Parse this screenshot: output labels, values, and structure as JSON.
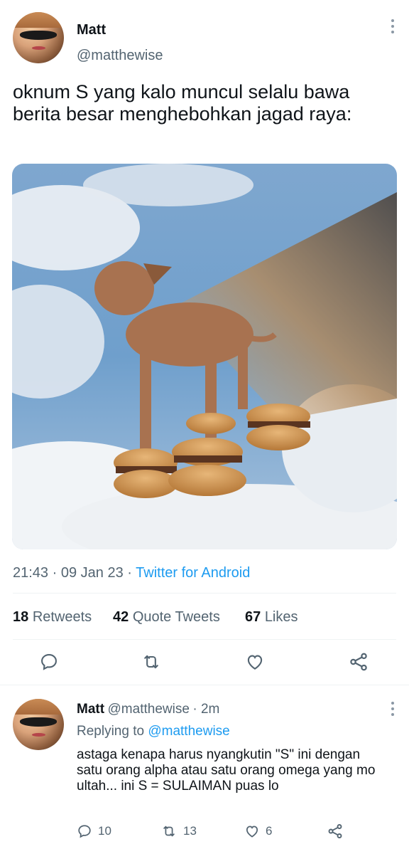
{
  "tweet": {
    "author_name": "Matt",
    "author_handle": "@matthewise",
    "text": "oknum S yang kalo muncul selalu bawa berita besar menghebohkan jagad raya:",
    "time": "21:43",
    "date": "09 Jan 23",
    "separator": "·",
    "source": "Twitter for Android",
    "image_description": "photo",
    "stats": {
      "retweets_count": "18",
      "retweets_label": "Retweets",
      "quotes_count": "42",
      "quotes_label": "Quote Tweets",
      "likes_count": "67",
      "likes_label": "Likes"
    }
  },
  "reply": {
    "author_name": "Matt",
    "author_handle": "@matthewise",
    "time_ago": "· 2m",
    "replying_prefix": "Replying to",
    "replying_handle": "@matthewise",
    "text": "astaga kenapa harus nyangkutin \"S\" ini dengan satu orang alpha atau satu orang omega yang mo ultah... ini S = SULAIMAN puas lo",
    "reply_count": "10",
    "retweet_count": "13",
    "like_count": "6"
  },
  "icons": [
    "more-icon",
    "reply-icon",
    "retweet-icon",
    "like-icon",
    "share-icon"
  ],
  "colors": {
    "accent": "#1d9bf0",
    "muted": "#536471",
    "text": "#0f1419",
    "divider": "#eff3f4"
  }
}
